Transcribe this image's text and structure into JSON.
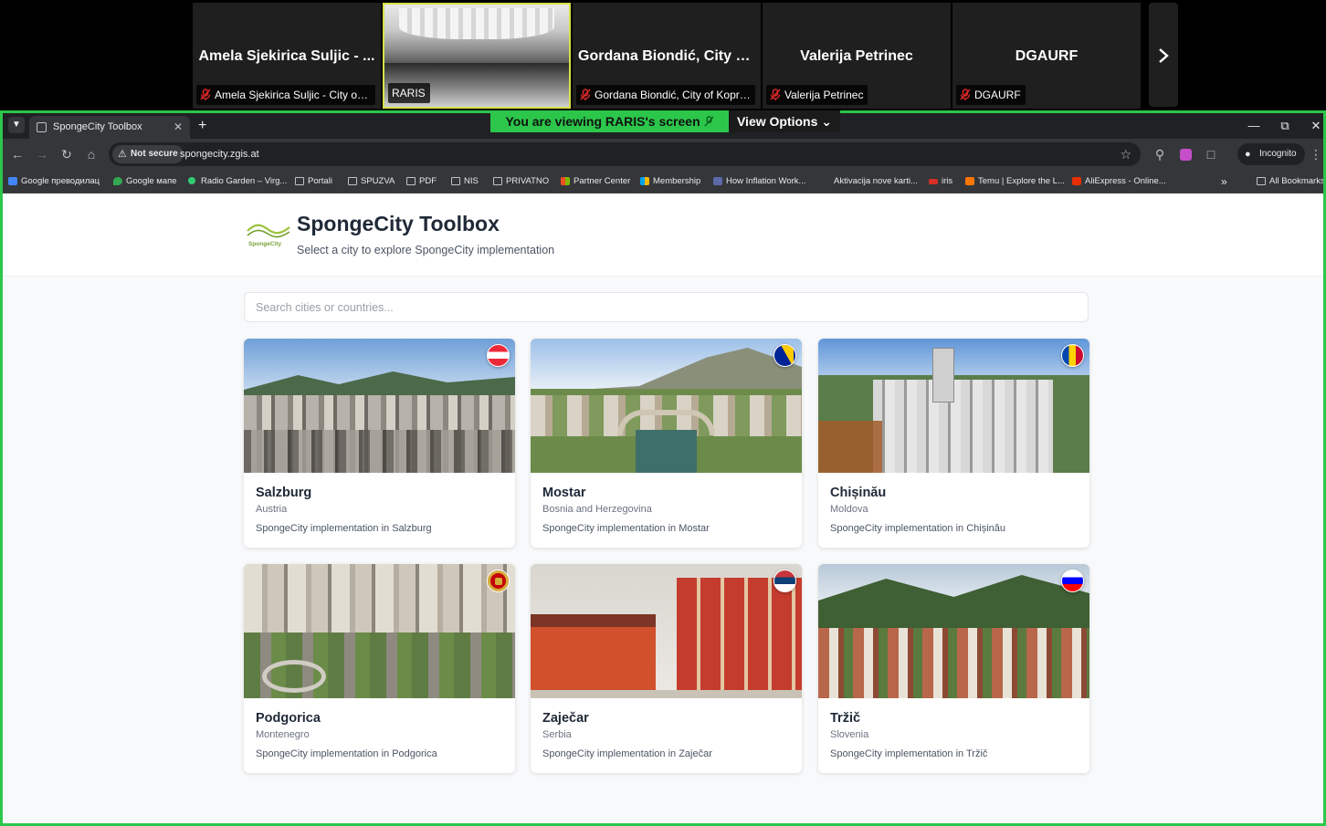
{
  "zoom": {
    "participants": [
      {
        "display_name": "Amela Sjekirica Suljic - ...",
        "label": "Amela Sjekirica Suljic - City of ...",
        "muted": true
      },
      {
        "display_name": "",
        "label": "RARIS",
        "muted": false,
        "video": true
      },
      {
        "display_name": "Gordana Biondić, City o...",
        "label": "Gordana Biondić, City of Kopriv...",
        "muted": true
      },
      {
        "display_name": "Valerija Petrinec",
        "label": "Valerija Petrinec",
        "muted": true
      },
      {
        "display_name": "DGAURF",
        "label": "DGAURF",
        "muted": true
      }
    ],
    "next_icon": "chevron-right-icon",
    "share_banner": {
      "prefix": "You are viewing",
      "name": "RARIS's screen"
    },
    "view_options_label": "View Options",
    "accent_color": "#2bc64a"
  },
  "browser": {
    "tab_title": "SpongeCity Toolbox",
    "new_tab_label": "+",
    "security_label": "Not secure",
    "url": "spongecity.zgis.at",
    "incognito_label": "Incognito",
    "bookmarks": [
      {
        "label": "Google преводилац",
        "icon": "google"
      },
      {
        "label": "Google мапе",
        "icon": "maps"
      },
      {
        "label": "Radio Garden – Virg...",
        "icon": "radio"
      },
      {
        "label": "Portali",
        "icon": "folder"
      },
      {
        "label": "SPUZVA",
        "icon": "folder"
      },
      {
        "label": "PDF",
        "icon": "folder"
      },
      {
        "label": "NIS",
        "icon": "folder"
      },
      {
        "label": "PRIVATNO",
        "icon": "folder"
      },
      {
        "label": "Partner Center",
        "icon": "ms"
      },
      {
        "label": "Membership",
        "icon": "ms"
      },
      {
        "label": "How Inflation Work...",
        "icon": "site"
      },
      {
        "label": "Aktivacija nove karti...",
        "icon": "site"
      },
      {
        "label": "iris",
        "icon": "iris"
      },
      {
        "label": "Temu | Explore the L...",
        "icon": "temu"
      },
      {
        "label": "AliExpress - Online...",
        "icon": "ali"
      }
    ],
    "more_bookmarks": "»",
    "all_bookmarks_label": "All Bookmarks"
  },
  "page": {
    "title": "SpongeCity Toolbox",
    "subtitle": "Select a city to explore SpongeCity implementation",
    "logo_text": "SpongeCity",
    "search_placeholder": "Search cities or countries...",
    "cities": [
      {
        "name": "Salzburg",
        "country": "Austria",
        "description": "SpongeCity implementation in Salzburg",
        "flag": "austria-flag-icon"
      },
      {
        "name": "Mostar",
        "country": "Bosnia and Herzegovina",
        "description": "SpongeCity implementation in Mostar",
        "flag": "bosnia-flag-icon"
      },
      {
        "name": "Chișinău",
        "country": "Moldova",
        "description": "SpongeCity implementation in Chișinău",
        "flag": "moldova-flag-icon"
      },
      {
        "name": "Podgorica",
        "country": "Montenegro",
        "description": "SpongeCity implementation in Podgorica",
        "flag": "montenegro-flag-icon"
      },
      {
        "name": "Zaječar",
        "country": "Serbia",
        "description": "SpongeCity implementation in Zaječar",
        "flag": "serbia-flag-icon"
      },
      {
        "name": "Tržič",
        "country": "Slovenia",
        "description": "SpongeCity implementation in Tržič",
        "flag": "slovenia-flag-icon"
      }
    ]
  }
}
